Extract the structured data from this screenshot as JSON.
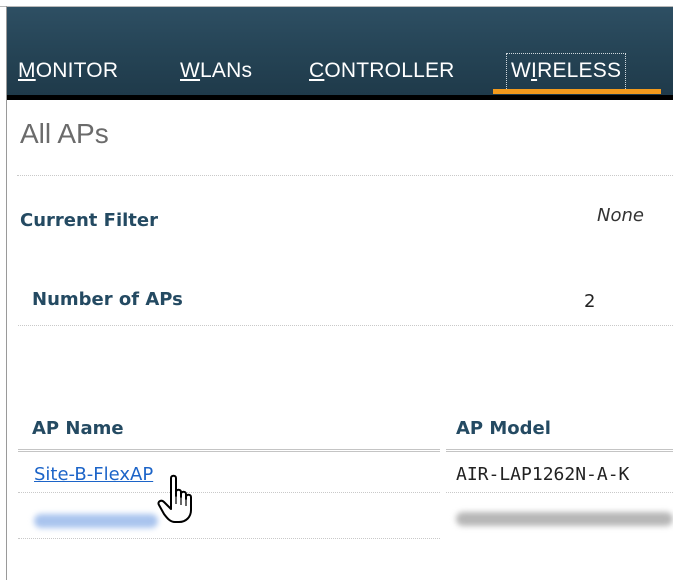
{
  "nav": {
    "items": [
      {
        "first": "M",
        "rest": "ONITOR",
        "before": ""
      },
      {
        "first": "W",
        "rest": "LANs",
        "before": ""
      },
      {
        "first": "C",
        "rest": "ONTROLLER",
        "before": ""
      },
      {
        "before": "W",
        "first": "I",
        "rest": "RELESS"
      }
    ],
    "active_index": 3
  },
  "page": {
    "title": "All APs"
  },
  "summary": {
    "filter_label": "Current Filter",
    "filter_value": "None",
    "count_label": "Number of APs",
    "count_value": "2"
  },
  "table": {
    "headers": [
      "AP Name",
      "AP Model"
    ],
    "rows": [
      {
        "name": "Site-B-FlexAP",
        "model": "AIR-LAP1262N-A-K"
      }
    ]
  },
  "icons": {
    "cursor": "hand-pointer-icon"
  },
  "colors": {
    "nav_bg": "#264557",
    "active_accent": "#f29a1d",
    "label": "#244a62",
    "link": "#1c64c8"
  }
}
